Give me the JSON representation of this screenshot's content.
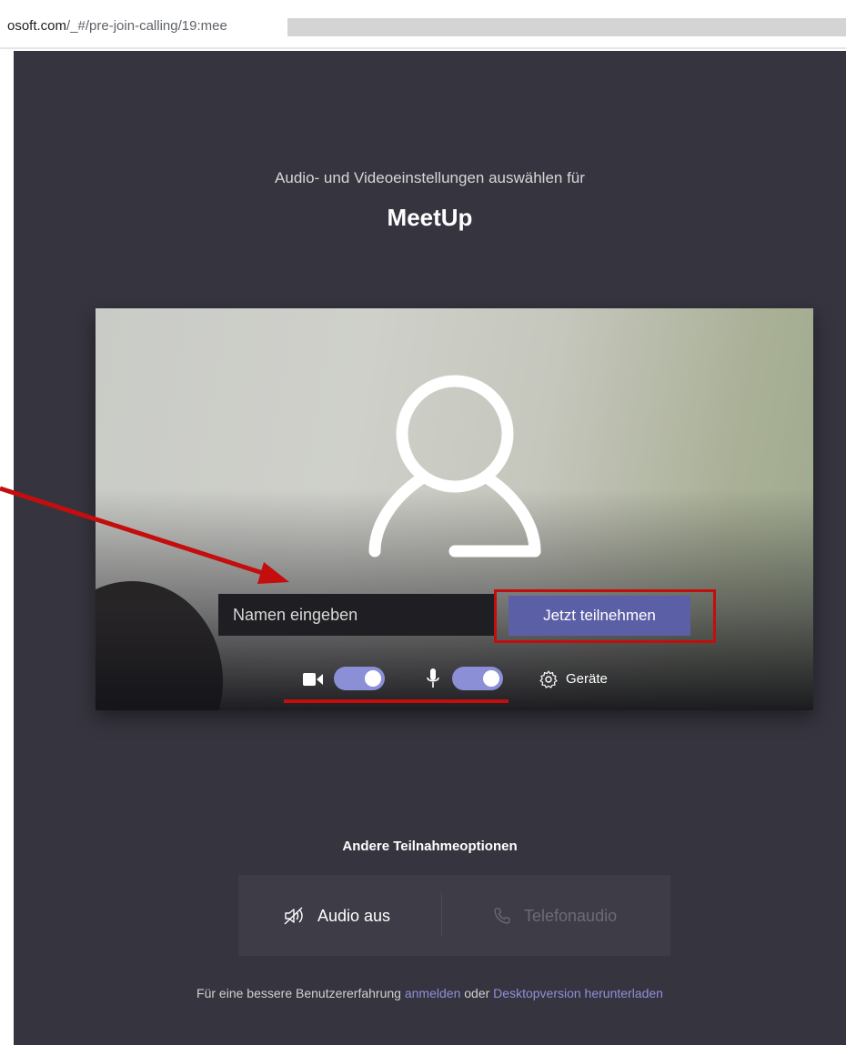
{
  "browser": {
    "url_domain": "osoft.com",
    "url_path": "/_#/pre-join-calling/19:mee"
  },
  "prejoin": {
    "prompt": "Audio- und Videoeinstellungen auswählen für",
    "meeting_title": "MeetUp",
    "name_placeholder": "Namen eingeben",
    "join_label": "Jetzt teilnehmen",
    "camera_on": true,
    "mic_on": true,
    "devices_label": "Geräte"
  },
  "other_options": {
    "title": "Andere Teilnahmeoptionen",
    "audio_off_label": "Audio aus",
    "phone_audio_label": "Telefonaudio"
  },
  "footer": {
    "text_before": "Für eine bessere Benutzererfahrung",
    "signin_link": "anmelden",
    "text_middle": "oder",
    "download_link": "Desktopversion herunterladen"
  },
  "colors": {
    "app_background": "#36353f",
    "accent": "#5b5fa6",
    "toggle_on": "#8b8fd6",
    "annotation_red": "#c40d0d",
    "link": "#8d90d8"
  },
  "icons": [
    "camera-icon",
    "microphone-icon",
    "gear-icon",
    "speaker-muted-icon",
    "phone-icon",
    "person-avatar-icon"
  ]
}
